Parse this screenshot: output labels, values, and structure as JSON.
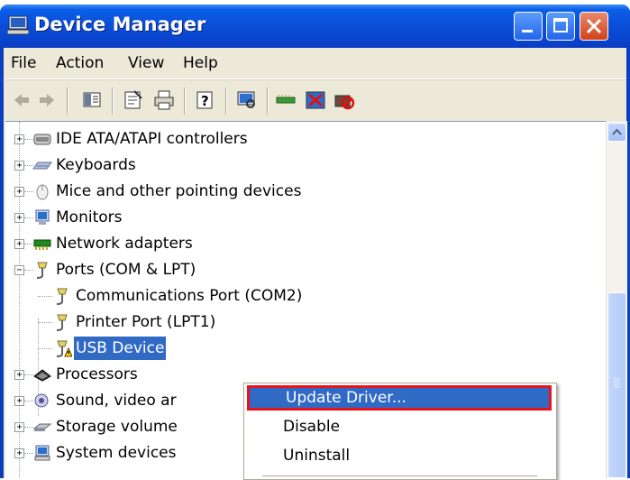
{
  "window": {
    "title": "Device Manager",
    "icon": "computer-icon"
  },
  "menubar": {
    "items": [
      "File",
      "Action",
      "View",
      "Help"
    ]
  },
  "toolbar": {
    "buttons": [
      "back-icon",
      "forward-icon",
      "show-hide-console-tree-icon",
      "properties-icon",
      "print-icon",
      "help-icon",
      "scan-hardware-icon",
      "update-driver-icon",
      "uninstall-icon",
      "disable-icon"
    ]
  },
  "tree": {
    "items": [
      {
        "label": "IDE ATA/ATAPI controllers",
        "icon": "ide-controller-icon"
      },
      {
        "label": "Keyboards",
        "icon": "keyboard-icon"
      },
      {
        "label": "Mice and other pointing devices",
        "icon": "mouse-icon"
      },
      {
        "label": "Monitors",
        "icon": "monitor-icon"
      },
      {
        "label": "Network adapters",
        "icon": "network-adapter-icon"
      },
      {
        "label": "Ports (COM & LPT)",
        "icon": "port-icon"
      },
      {
        "label": "Communications Port (COM2)",
        "icon": "port-icon"
      },
      {
        "label": "Printer Port (LPT1)",
        "icon": "port-icon"
      },
      {
        "label": "USB Device",
        "icon": "port-warning-icon"
      },
      {
        "label": "Processors",
        "icon": "processor-icon"
      },
      {
        "label": "Sound, video ar",
        "icon": "sound-icon"
      },
      {
        "label": "Storage volume",
        "icon": "storage-icon"
      },
      {
        "label": "System devices",
        "icon": "system-icon"
      }
    ]
  },
  "context_menu": {
    "items": [
      "Update Driver...",
      "Disable",
      "Uninstall"
    ]
  },
  "colors": {
    "selection": "#316ac5",
    "highlight_border": "#e8141b",
    "titlebar": "#0a4fd8"
  }
}
